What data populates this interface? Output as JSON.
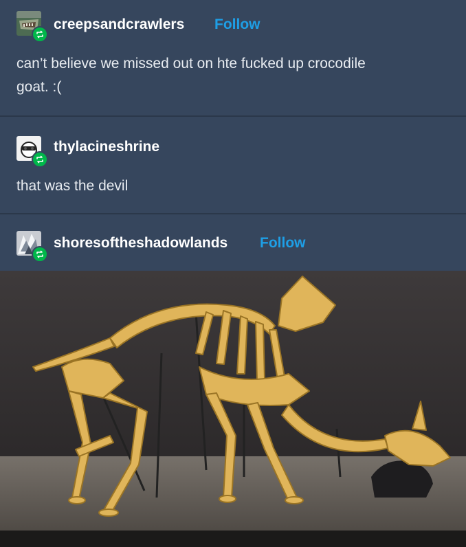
{
  "posts": [
    {
      "username": "creepsandcrawlers",
      "follow_label": "Follow",
      "lines": [
        "can’t believe we missed out on hte fucked up crocodile",
        "goat. :("
      ]
    },
    {
      "username": "thylacineshrine",
      "lines": [
        "that was the devil"
      ]
    },
    {
      "username": "shoresoftheshadowlands",
      "follow_label": "Follow"
    }
  ],
  "colors": {
    "background": "#36465d",
    "follow": "#1e9fe6",
    "reblog_badge": "#00b74a"
  },
  "icons": [
    "reblog-icon"
  ]
}
